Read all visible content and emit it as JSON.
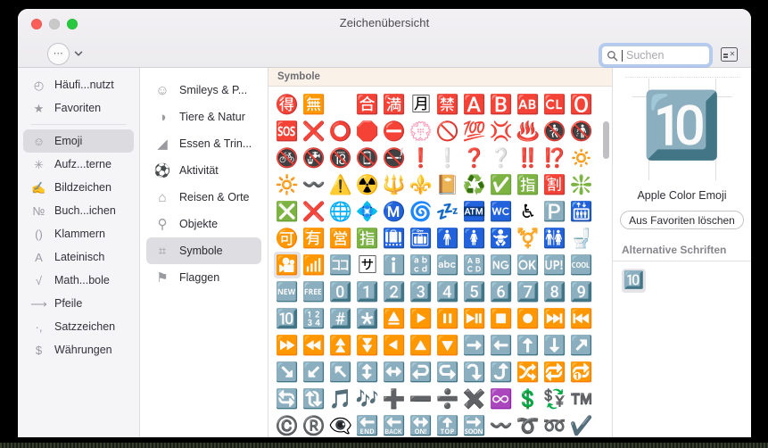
{
  "window": {
    "title": "Zeichenübersicht",
    "traffic_lights": [
      "close",
      "minimize",
      "zoom"
    ]
  },
  "toolbar": {
    "action_button_label": "⋯",
    "chevron_icon": "chevron-down",
    "card_button_icon": "character-card"
  },
  "search": {
    "placeholder": "Suchen",
    "value": "",
    "focused": true
  },
  "sidebar": {
    "items": [
      {
        "icon": "◴",
        "label": "Häufi...nutzt",
        "selected": false
      },
      {
        "icon": "★",
        "label": "Favoriten",
        "selected": false
      },
      {
        "icon": "☺",
        "label": "Emoji",
        "selected": true
      },
      {
        "icon": "✳",
        "label": "Aufz...terne",
        "selected": false
      },
      {
        "icon": "✍",
        "label": "Bildzeichen",
        "selected": false
      },
      {
        "icon": "№",
        "label": "Buch...ichen",
        "selected": false
      },
      {
        "icon": "()",
        "label": "Klammern",
        "selected": false
      },
      {
        "icon": "A",
        "label": "Lateinisch",
        "selected": false
      },
      {
        "icon": "√",
        "label": "Math...bole",
        "selected": false
      },
      {
        "icon": "⟶",
        "label": "Pfeile",
        "selected": false
      },
      {
        "icon": "·,",
        "label": "Satzzeichen",
        "selected": false
      },
      {
        "icon": "$",
        "label": "Währungen",
        "selected": false
      }
    ],
    "separator_after_index": 1
  },
  "categories": {
    "items": [
      {
        "icon": "☺",
        "label": "Smileys & P...",
        "selected": false
      },
      {
        "icon": "◑",
        "label": "Tiere & Natur",
        "selected": false
      },
      {
        "icon": "◢",
        "label": "Essen & Trin...",
        "selected": false
      },
      {
        "icon": "⚽",
        "label": "Aktivität",
        "selected": false
      },
      {
        "icon": "⌂",
        "label": "Reisen & Orte",
        "selected": false
      },
      {
        "icon": "⚲",
        "label": "Objekte",
        "selected": false
      },
      {
        "icon": "⌗",
        "label": "Symbole",
        "selected": true
      },
      {
        "icon": "⚑",
        "label": "Flaggen",
        "selected": false
      }
    ]
  },
  "grid": {
    "header": "Symbole",
    "selected_index": 72,
    "columns": 12,
    "glyphs": [
      "🉐",
      "🈚",
      "🉝",
      "🈴",
      "🈵",
      "🈷",
      "🈲",
      "🅰️",
      "🅱️",
      "🆎",
      "🆑",
      "🅾️",
      "🆘",
      "❌",
      "⭕",
      "🛑",
      "⛔",
      "💮",
      "🚫",
      "💯",
      "💢",
      "♨️",
      "🚷",
      "🚯",
      "🚳",
      "🚱",
      "🔞",
      "📵",
      "🚭",
      "❗",
      "❕",
      "❓",
      "❔",
      "‼️",
      "⁉️",
      "🔅",
      "🔆",
      "〰️",
      "⚠️",
      "☢️",
      "🔱",
      "⚜️",
      "📔",
      "♻️",
      "✅",
      "🈯",
      "🈹",
      "❇️",
      "❎",
      "❌",
      "🌐",
      "💠",
      "Ⓜ️",
      "🌀",
      "💤",
      "🏧",
      "🚾",
      "♿",
      "🅿️",
      "🛗",
      "🉑",
      "🈶",
      "🈺",
      "🈯",
      "🛄",
      "🛅",
      "🚹",
      "🚺",
      "🚼",
      "⚧️",
      "🚻",
      "🚽",
      "🎦",
      "📶",
      "🈁",
      "🈂",
      "ℹ️",
      "🔡",
      "🔤",
      "🔠",
      "🆖",
      "🆗",
      "🆙",
      "🆒",
      "🆕",
      "🆓",
      "0️⃣",
      "1️⃣",
      "2️⃣",
      "3️⃣",
      "4️⃣",
      "5️⃣",
      "6️⃣",
      "7️⃣",
      "8️⃣",
      "9️⃣",
      "🔟",
      "🔢",
      "#️⃣",
      "*️⃣",
      "⏏️",
      "▶️",
      "⏸️",
      "⏯️",
      "⏹️",
      "⏺️",
      "⏭️",
      "⏮️",
      "⏩",
      "⏪",
      "⏫",
      "⏬",
      "◀️",
      "🔼",
      "🔽",
      "➡️",
      "⬅️",
      "⬆️",
      "⬇️",
      "↗️",
      "↘️",
      "↙️",
      "↖️",
      "↕️",
      "↔️",
      "↩️",
      "↪️",
      "⤵️",
      "⤴️",
      "🔀",
      "🔁",
      "🔂",
      "🔄",
      "🔃",
      "🎵",
      "🎶",
      "➕",
      "➖",
      "➗",
      "✖️",
      "♾️",
      "💲",
      "💱",
      "™️",
      "©️",
      "®️",
      "👁‍🗨",
      "🔚",
      "🔙",
      "🔛",
      "🔝",
      "🔜",
      "〰️",
      "➰",
      "➿",
      "✔️"
    ]
  },
  "scrollbar": {
    "visible": true
  },
  "info": {
    "preview_glyph": "🔟",
    "font_name": "Apple Color Emoji",
    "favorite_button": "Aus Favoriten löschen",
    "alternatives_header": "Alternative Schriften",
    "alternatives": [
      "🔟"
    ]
  },
  "colors": {
    "titlebar": "#f0eef2",
    "sidebar_bg": "#f5f4f7",
    "selection": "#dcdbdf",
    "grid_header_bg": "#faf1e8",
    "search_focus_ring": "#5a96f0"
  }
}
